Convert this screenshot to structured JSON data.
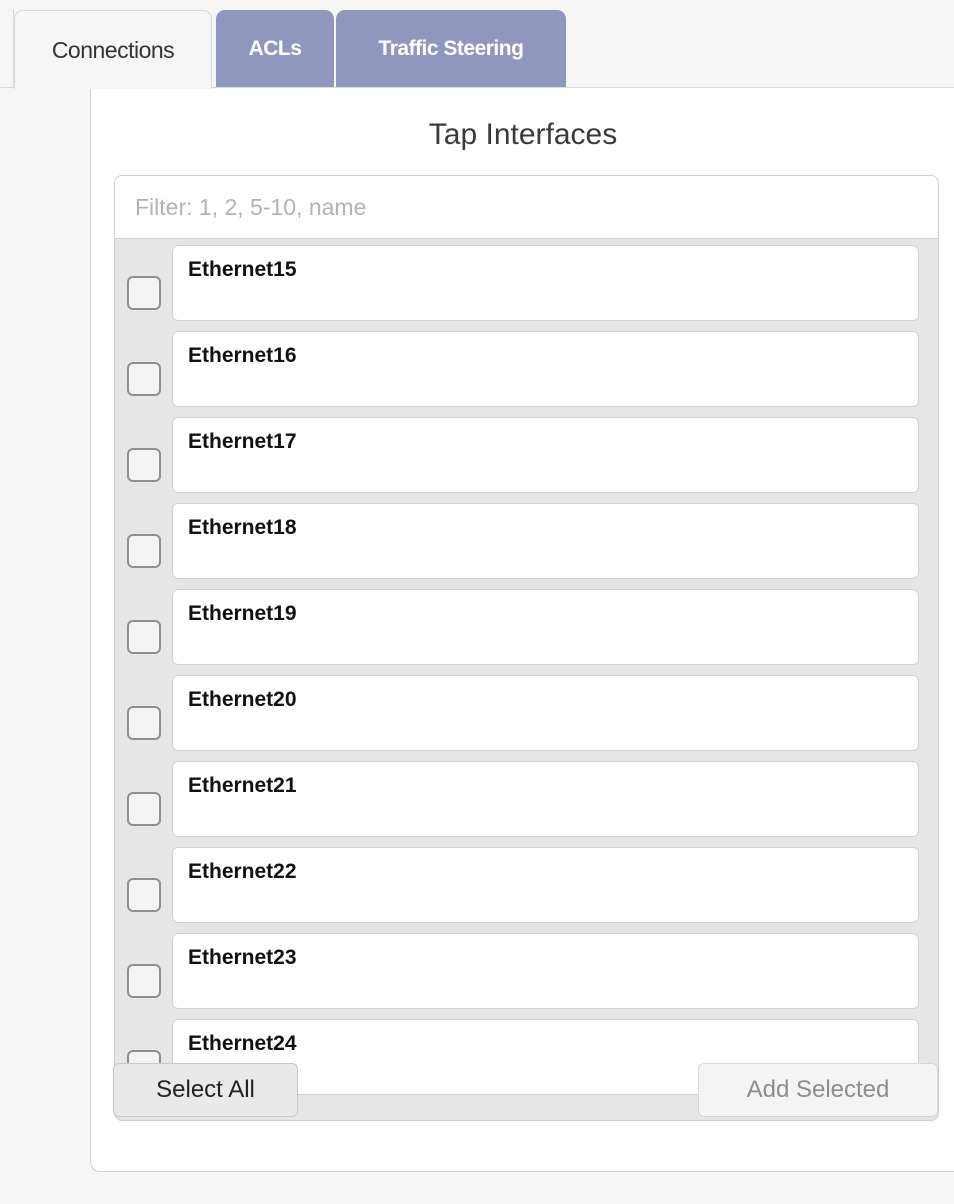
{
  "tabs": [
    {
      "label": "Connections",
      "active": true
    },
    {
      "label": "ACLs",
      "active": false
    },
    {
      "label": "Traffic Steering",
      "active": false
    }
  ],
  "panel": {
    "title": "Tap Interfaces",
    "filter_placeholder": "Filter: 1, 2, 5-10, name",
    "filter_value": "",
    "items": [
      {
        "name": "Ethernet15",
        "checked": false
      },
      {
        "name": "Ethernet16",
        "checked": false
      },
      {
        "name": "Ethernet17",
        "checked": false
      },
      {
        "name": "Ethernet18",
        "checked": false
      },
      {
        "name": "Ethernet19",
        "checked": false
      },
      {
        "name": "Ethernet20",
        "checked": false
      },
      {
        "name": "Ethernet21",
        "checked": false
      },
      {
        "name": "Ethernet22",
        "checked": false
      },
      {
        "name": "Ethernet23",
        "checked": false
      },
      {
        "name": "Ethernet24",
        "checked": false
      }
    ],
    "select_all_label": "Select All",
    "add_selected_label": "Add Selected"
  },
  "colors": {
    "inactive_tab_bg": "#8f97bf",
    "inactive_tab_text": "#ffffff",
    "page_bg": "#f6f6f6",
    "disabled_text": "#8c8c8c"
  }
}
